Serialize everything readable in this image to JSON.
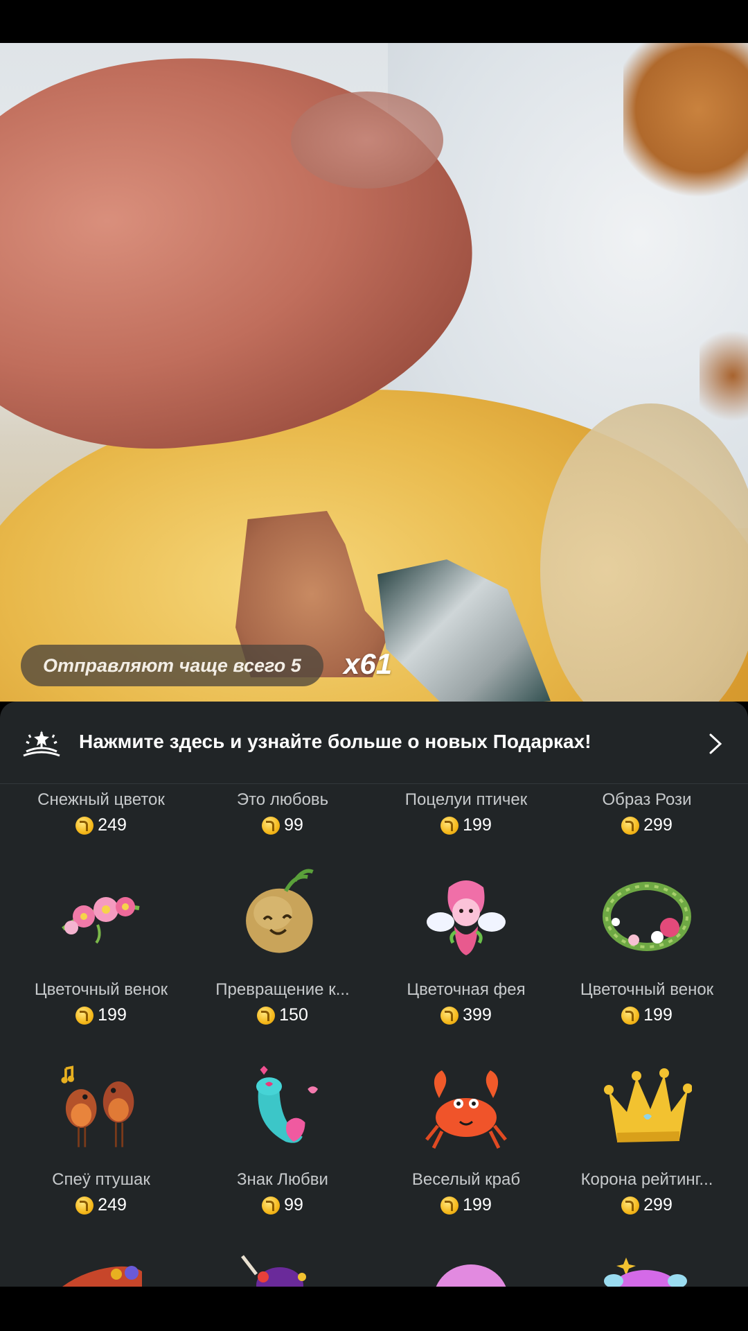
{
  "combo": {
    "text": "Отправляют чаще всего 5",
    "multiplier": "x61"
  },
  "banner": {
    "text": "Нажмите здесь и узнайте больше о новых Подарках!",
    "icon": "gift-spark-icon",
    "chevron_icon": "chevron-right-icon"
  },
  "gifts": [
    {
      "name": "Снежный цветок",
      "price": "249"
    },
    {
      "name": "Это любовь",
      "price": "99"
    },
    {
      "name": "Поцелуи птичек",
      "price": "199"
    },
    {
      "name": "Образ Рози",
      "price": "299"
    },
    {
      "name": "Цветочный венок",
      "price": "199",
      "icon": "flower-wreath-icon"
    },
    {
      "name": "Превращение к...",
      "price": "150",
      "icon": "potato-sprout-icon"
    },
    {
      "name": "Цветочная фея",
      "price": "399",
      "icon": "flower-fairy-icon"
    },
    {
      "name": "Цветочный венок",
      "price": "199",
      "icon": "flower-ring-icon"
    },
    {
      "name": "Спеӱ птушак",
      "price": "249",
      "icon": "singing-birds-icon"
    },
    {
      "name": "Знак Любви",
      "price": "99",
      "icon": "love-sign-icon"
    },
    {
      "name": "Веселый краб",
      "price": "199",
      "icon": "crab-icon"
    },
    {
      "name": "Корона рейтинг...",
      "price": "299",
      "icon": "crown-icon"
    }
  ],
  "colors": {
    "panel_bg": "#212527",
    "coin": "#f5b81a"
  }
}
